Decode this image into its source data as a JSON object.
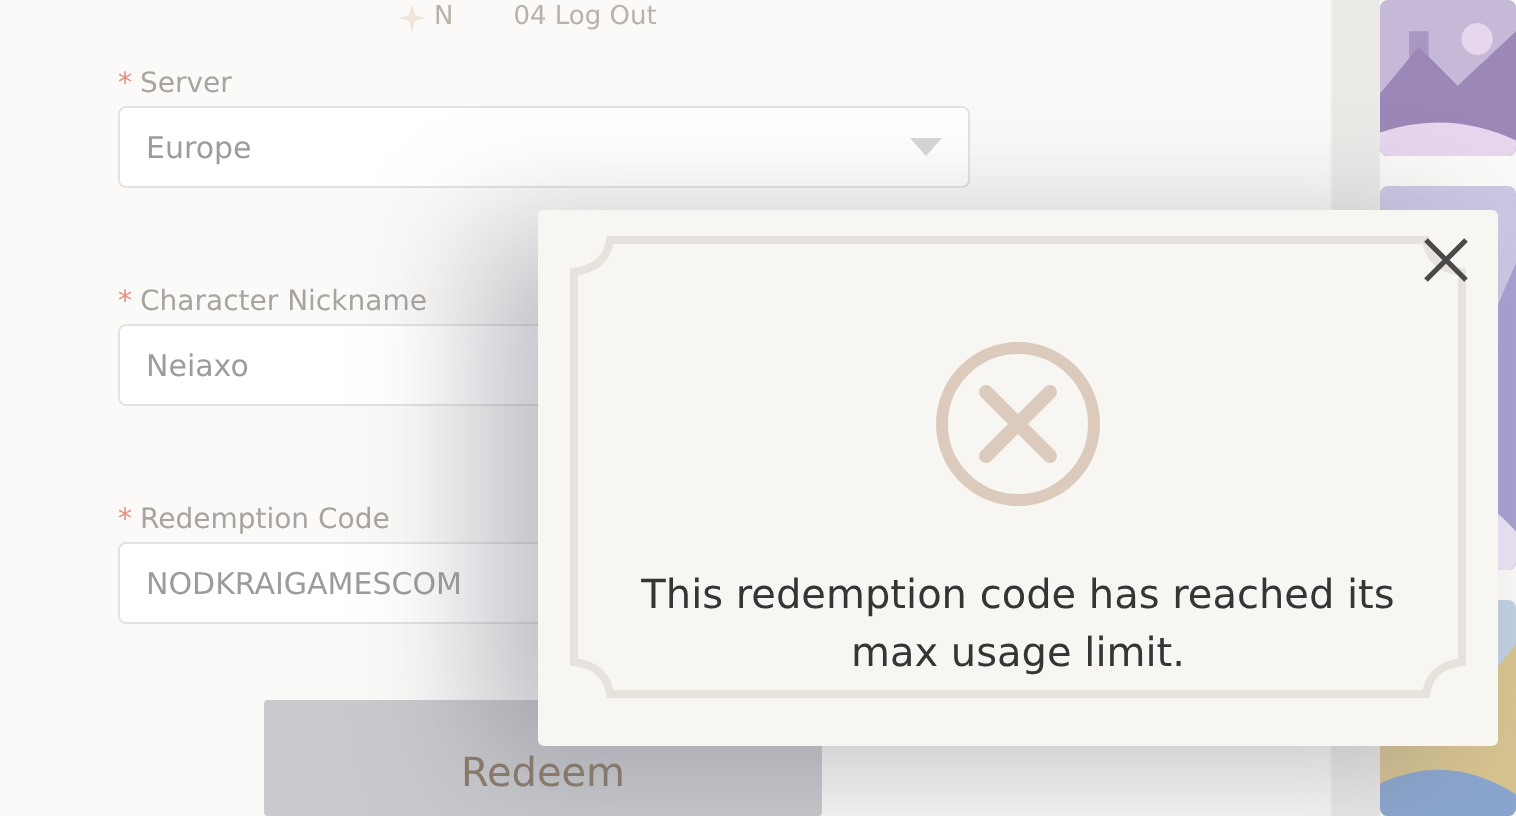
{
  "top_nav": [
    {
      "text": "N",
      "kind": "star"
    },
    {
      "text": "04 Log Out",
      "kind": "plain"
    }
  ],
  "form": {
    "fields": [
      {
        "label": "Server",
        "required": true,
        "value": "Europe",
        "kind": "select"
      },
      {
        "label": "Character Nickname",
        "required": true,
        "value": "Neiaxo",
        "kind": "text"
      },
      {
        "label": "Redemption Code",
        "required": true,
        "value": "NODKRAIGAMESCOM",
        "kind": "text"
      }
    ],
    "required_mark": "*",
    "submit": "Redeem"
  },
  "dialog": {
    "message": "This redemption code has reached its max usage limit."
  }
}
